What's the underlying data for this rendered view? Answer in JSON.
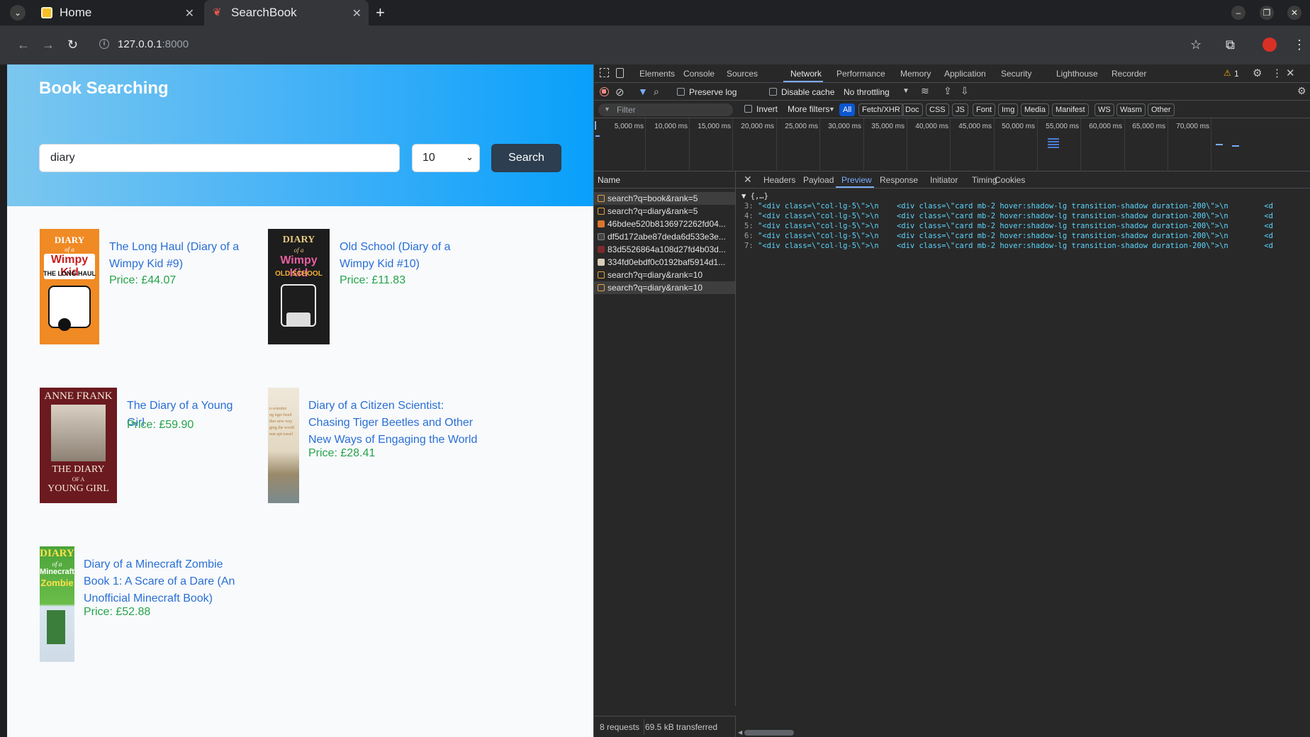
{
  "tabs": [
    {
      "title": "Home",
      "active": false
    },
    {
      "title": "SearchBook",
      "active": true
    }
  ],
  "url": {
    "host": "127.0.0.1",
    "port": ":8000"
  },
  "page": {
    "heading": "Book Searching",
    "search_value": "diary",
    "rank_value": "10",
    "search_button": "Search",
    "books": [
      {
        "title": "The Long Haul (Diary of a Wimpy Kid #9)",
        "price": "Price: £44.07",
        "cover": {
          "bg": "#f08a24",
          "text": "DIARY of a Wimpy Kid THE LONG HAUL"
        }
      },
      {
        "title": "Old School (Diary of a Wimpy Kid #10)",
        "price": "Price: £11.83",
        "cover": {
          "bg": "#1d1d1d",
          "text": "DIARY of a Wimpy Kid OLD SCHOOL"
        }
      },
      {
        "title": "The Diary of a Young Girl",
        "price": "Price: £59.90",
        "cover": {
          "bg": "#6b1a1f",
          "text": "ANNE FRANK THE DIARY OF A YOUNG GIRL"
        }
      },
      {
        "title": "Diary of a Citizen Scientist: Chasing Tiger Beetles and Other New Ways of Engaging the World",
        "price": "Price: £28.41",
        "cover": {
          "bg": "#d9cdb4",
          "text": ""
        }
      },
      {
        "title": "Diary of a Minecraft Zombie Book 1: A Scare of a Dare (An Unofficial Minecraft Book)",
        "price": "Price: £52.88",
        "cover": {
          "bg": "#4a8a3a",
          "text": "DIARY of a Minecraft Zombie"
        }
      }
    ]
  },
  "devtools": {
    "tabs": [
      "Elements",
      "Console",
      "Sources",
      "Network",
      "Performance",
      "Memory",
      "Application",
      "Security",
      "Lighthouse",
      "Recorder"
    ],
    "active_tab": "Network",
    "warning_count": "1",
    "preserve_log": "Preserve log",
    "disable_cache": "Disable cache",
    "throttling": "No throttling",
    "filter_placeholder": "Filter",
    "invert": "Invert",
    "more_filters": "More filters",
    "type_filters": [
      "All",
      "Fetch/XHR",
      "Doc",
      "CSS",
      "JS",
      "Font",
      "Img",
      "Media",
      "Manifest",
      "WS",
      "Wasm",
      "Other"
    ],
    "timeline_ticks": [
      "5,000 ms",
      "10,000 ms",
      "15,000 ms",
      "20,000 ms",
      "25,000 ms",
      "30,000 ms",
      "35,000 ms",
      "40,000 ms",
      "45,000 ms",
      "50,000 ms",
      "55,000 ms",
      "60,000 ms",
      "65,000 ms",
      "70,000 ms"
    ],
    "name_header": "Name",
    "requests": [
      {
        "name": "search?q=book&rank=5",
        "type": "xhr"
      },
      {
        "name": "search?q=diary&rank=5",
        "type": "xhr"
      },
      {
        "name": "46bdee520b8136972262fd04...",
        "type": "img"
      },
      {
        "name": "df5d172abe87deda6d533e3e...",
        "type": "img"
      },
      {
        "name": "83d5526864a108d27fd4b03d...",
        "type": "img"
      },
      {
        "name": "334fd0ebdf0c0192baf5914d1...",
        "type": "img"
      },
      {
        "name": "search?q=diary&rank=10",
        "type": "xhr"
      },
      {
        "name": "search?q=diary&rank=10",
        "type": "xhr"
      }
    ],
    "detail_tabs": [
      "Headers",
      "Payload",
      "Preview",
      "Response",
      "Initiator",
      "Timing",
      "Cookies"
    ],
    "active_detail_tab": "Preview",
    "preview_root": "▼ {,…}",
    "preview_lines": [
      {
        "key": "3:",
        "value": "\"<div class=\\\"col-lg-5\\\">\\n    <div class=\\\"card mb-2 hover:shadow-lg transition-shadow duration-200\\\">\\n        <d"
      },
      {
        "key": "4:",
        "value": "\"<div class=\\\"col-lg-5\\\">\\n    <div class=\\\"card mb-2 hover:shadow-lg transition-shadow duration-200\\\">\\n        <d"
      },
      {
        "key": "5:",
        "value": "\"<div class=\\\"col-lg-5\\\">\\n    <div class=\\\"card mb-2 hover:shadow-lg transition-shadow duration-200\\\">\\n        <d"
      },
      {
        "key": "6:",
        "value": "\"<div class=\\\"col-lg-5\\\">\\n    <div class=\\\"card mb-2 hover:shadow-lg transition-shadow duration-200\\\">\\n        <d"
      },
      {
        "key": "7:",
        "value": "\"<div class=\\\"col-lg-5\\\">\\n    <div class=\\\"card mb-2 hover:shadow-lg transition-shadow duration-200\\\">\\n        <d"
      }
    ],
    "status_requests": "8 requests",
    "status_transferred": "69.5 kB transferred"
  }
}
